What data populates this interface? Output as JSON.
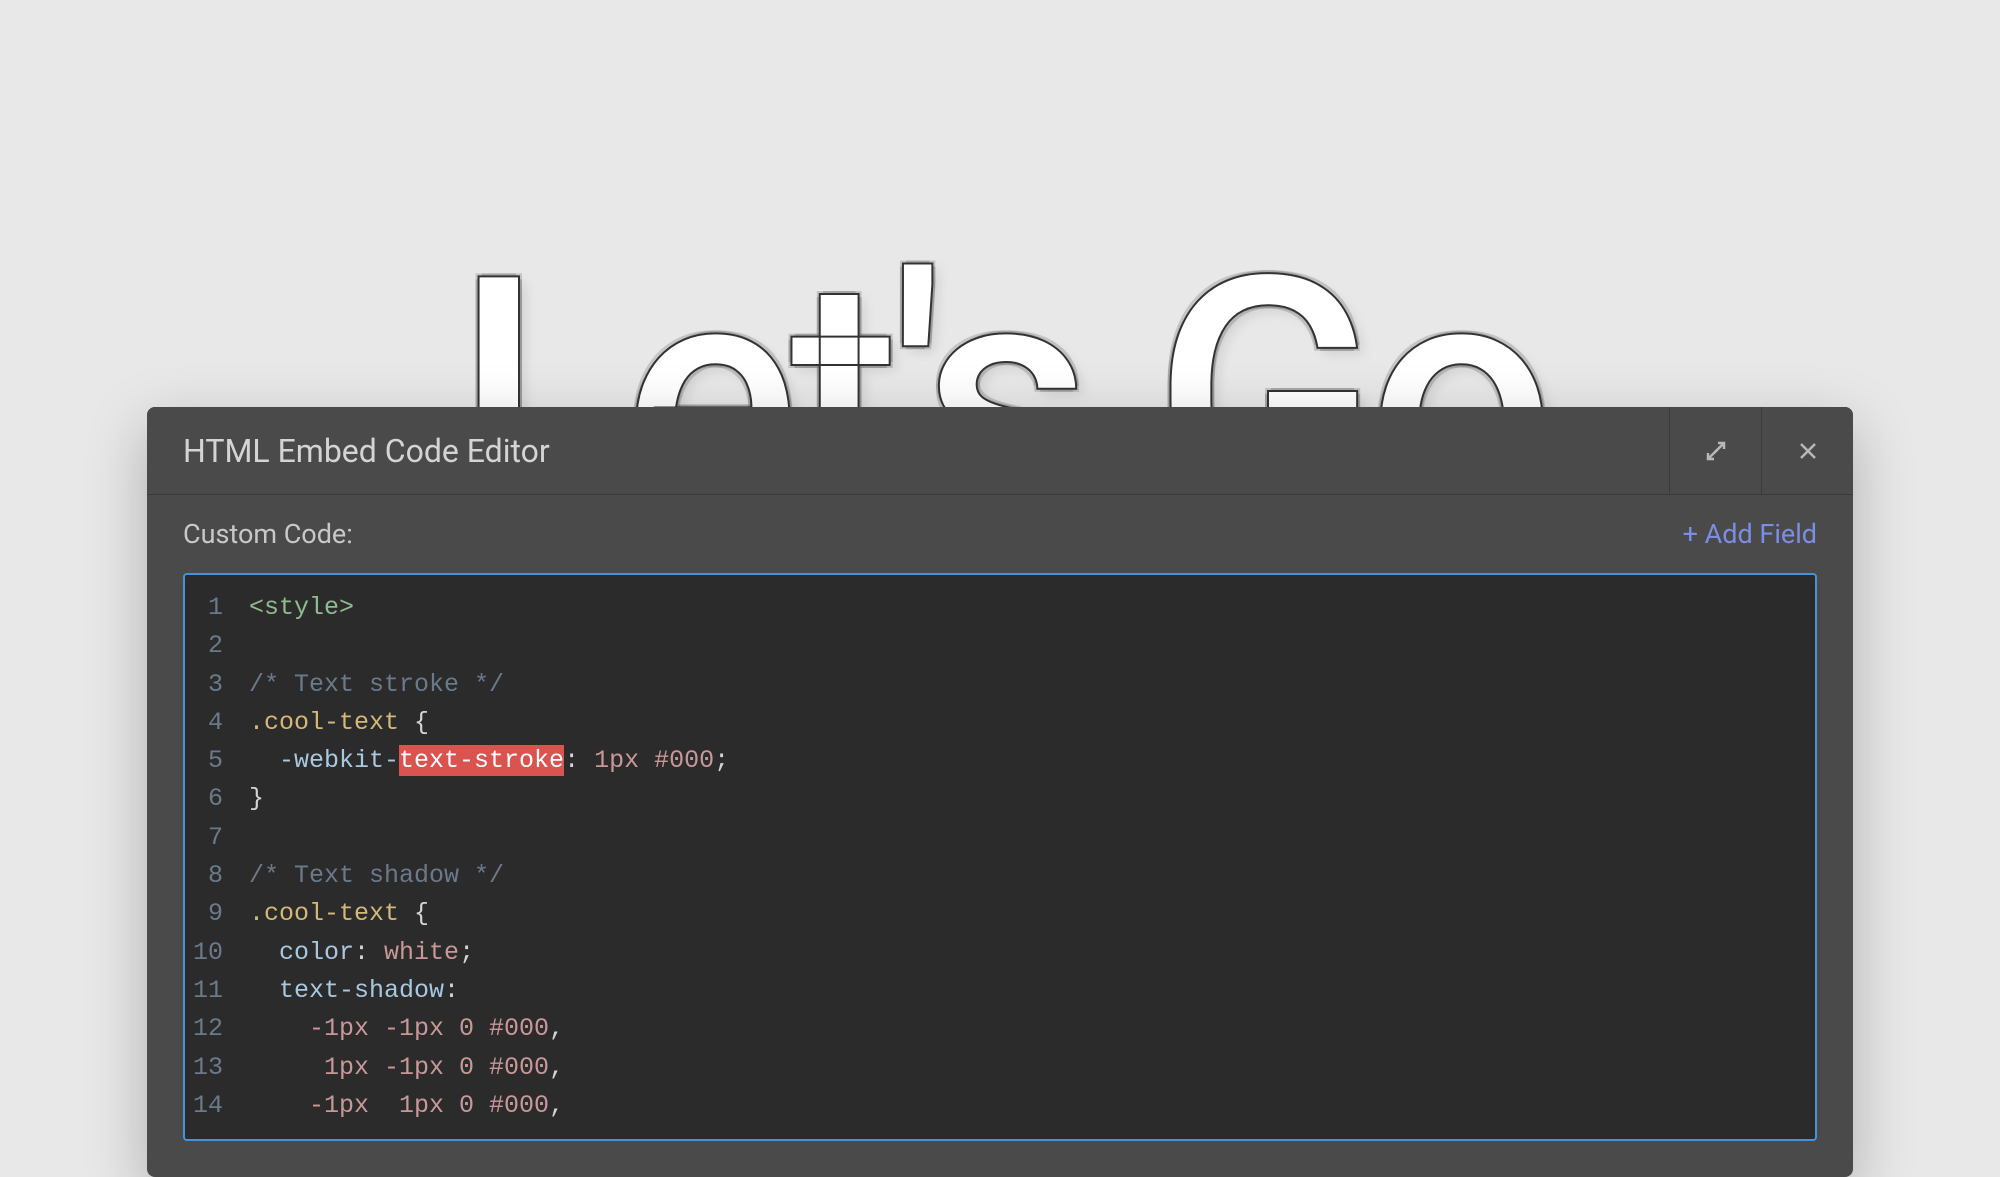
{
  "hero": {
    "text": "Let's Go"
  },
  "modal": {
    "title": "HTML Embed Code Editor",
    "subtitle": "Custom Code:",
    "addFieldLabel": "+ Add Field"
  },
  "code": {
    "lines": [
      {
        "n": "1",
        "tokens": [
          {
            "cls": "tok-tag",
            "t": "<style>"
          }
        ]
      },
      {
        "n": "2",
        "tokens": []
      },
      {
        "n": "3",
        "tokens": [
          {
            "cls": "tok-comment",
            "t": "/* Text stroke */"
          }
        ]
      },
      {
        "n": "4",
        "tokens": [
          {
            "cls": "tok-selector",
            "t": ".cool-text"
          },
          {
            "cls": "tok-punct",
            "t": " "
          },
          {
            "cls": "tok-brace",
            "t": "{"
          }
        ]
      },
      {
        "n": "5",
        "tokens": [
          {
            "cls": "tok-property",
            "t": "  -webkit-"
          },
          {
            "cls": "tok-highlight",
            "t": "text-stroke"
          },
          {
            "cls": "tok-punct",
            "t": ": "
          },
          {
            "cls": "tok-value",
            "t": "1px #000"
          },
          {
            "cls": "tok-punct",
            "t": ";"
          }
        ]
      },
      {
        "n": "6",
        "tokens": [
          {
            "cls": "tok-brace",
            "t": "}"
          }
        ]
      },
      {
        "n": "7",
        "tokens": []
      },
      {
        "n": "8",
        "tokens": [
          {
            "cls": "tok-comment",
            "t": "/* Text shadow */"
          }
        ]
      },
      {
        "n": "9",
        "tokens": [
          {
            "cls": "tok-selector",
            "t": ".cool-text"
          },
          {
            "cls": "tok-punct",
            "t": " "
          },
          {
            "cls": "tok-brace",
            "t": "{"
          }
        ]
      },
      {
        "n": "10",
        "tokens": [
          {
            "cls": "tok-property",
            "t": "  color"
          },
          {
            "cls": "tok-punct",
            "t": ": "
          },
          {
            "cls": "tok-value",
            "t": "white"
          },
          {
            "cls": "tok-punct",
            "t": ";"
          }
        ]
      },
      {
        "n": "11",
        "tokens": [
          {
            "cls": "tok-property",
            "t": "  text-shadow"
          },
          {
            "cls": "tok-punct",
            "t": ":"
          }
        ]
      },
      {
        "n": "12",
        "tokens": [
          {
            "cls": "tok-value",
            "t": "    -1px -1px 0 #000"
          },
          {
            "cls": "tok-punct",
            "t": ","
          }
        ]
      },
      {
        "n": "13",
        "tokens": [
          {
            "cls": "tok-value",
            "t": "     1px -1px 0 #000"
          },
          {
            "cls": "tok-punct",
            "t": ","
          }
        ]
      },
      {
        "n": "14",
        "tokens": [
          {
            "cls": "tok-value",
            "t": "    -1px  1px 0 #000"
          },
          {
            "cls": "tok-punct",
            "t": ","
          }
        ]
      }
    ]
  }
}
